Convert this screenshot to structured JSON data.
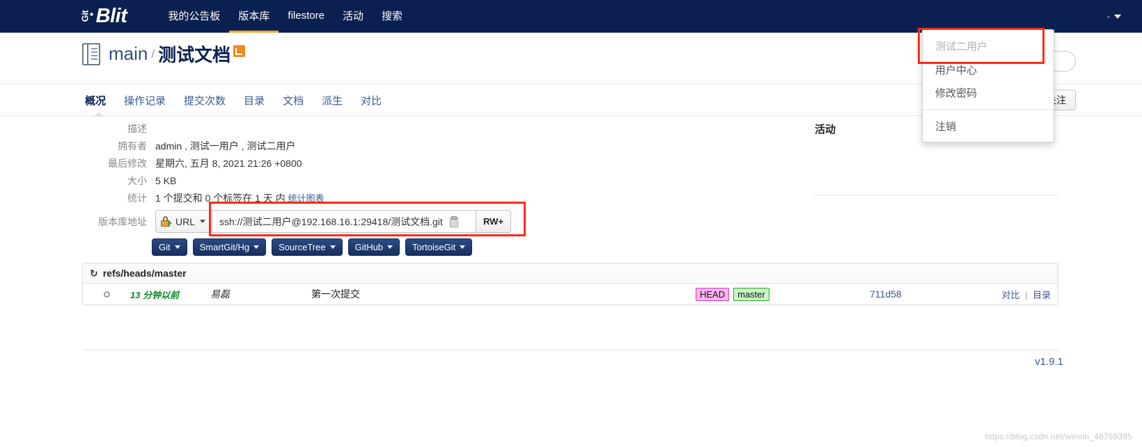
{
  "topnav": {
    "logo": {
      "git": "Git",
      "dot": "·",
      "blit": "Blit"
    },
    "items": [
      {
        "label": "我的公告板",
        "active": false
      },
      {
        "label": "版本库",
        "active": true
      },
      {
        "label": "filestore",
        "active": false
      },
      {
        "label": "活动",
        "active": false
      },
      {
        "label": "搜索",
        "active": false
      }
    ],
    "user": {
      "name": "-",
      "caret_icon": "chevron-down-icon"
    }
  },
  "user_menu": {
    "header": "测试二用户",
    "items": [
      "用户中心",
      "修改密码"
    ],
    "logout": "注销"
  },
  "repo_header": {
    "project": "main",
    "separator": "/",
    "name": "测试文档",
    "rss_icon": "rss-icon",
    "book_icon": "repository-book-icon"
  },
  "search": {
    "placeholder": "搜索",
    "value": "",
    "icon": "search-icon"
  },
  "tabs": [
    {
      "label": "概况",
      "active": true
    },
    {
      "label": "操作记录",
      "active": false
    },
    {
      "label": "提交次数",
      "active": false
    },
    {
      "label": "目录",
      "active": false
    },
    {
      "label": "文档",
      "active": false
    },
    {
      "label": "派生",
      "active": false
    },
    {
      "label": "对比",
      "active": false
    }
  ],
  "star_button": {
    "glyph": "★",
    "label": "关注"
  },
  "info": {
    "rows": [
      {
        "label": "描述",
        "value": ""
      },
      {
        "label": "拥有者",
        "value": "admin , 测试一用户 , 测试二用户"
      },
      {
        "label": "最后修改",
        "value": "星期六, 五月 8, 2021 21:26 +0800"
      },
      {
        "label": "大小",
        "value": "5 KB"
      },
      {
        "label": "统计",
        "value": "1 个提交和 0 个标签在 1 天 内",
        "link": "统计图表"
      }
    ],
    "url_label": "版本库地址",
    "url_type": "URL",
    "url_value": "ssh://测试二用户@192.168.16.1:29418/测试文档.git",
    "copy_icon": "clipboard-icon",
    "lock_icon": "lock-icon",
    "access_badge": "RW+"
  },
  "client_buttons": [
    {
      "label": "Git"
    },
    {
      "label": "SmartGit/Hg"
    },
    {
      "label": "SourceTree"
    },
    {
      "label": "GitHub"
    },
    {
      "label": "TortoiseGit"
    }
  ],
  "activity": {
    "title": "活动"
  },
  "refs": {
    "header": "refs/heads/master",
    "refresh_icon": "refresh-icon",
    "rows": [
      {
        "age": "13 分钟以前",
        "author": "易磊",
        "message": "第一次提交",
        "head_tag": "HEAD",
        "branch_tag": "master",
        "sha": "711d58",
        "action_diff": "对比",
        "action_sep": "|",
        "action_tree": "目录"
      }
    ]
  },
  "footer": {
    "version": "v1.9.1"
  },
  "watermark": "https://blog.csdn.net/weixin_46759395",
  "colors": {
    "nav_bg": "#0a2050",
    "accent": "#f6a623",
    "link": "#3a5a92",
    "annotation": "#ff2b17",
    "head_tag_bg": "#ffb3f0",
    "branch_tag_bg": "#c8f7c5",
    "age_green": "#0a8a2a"
  }
}
